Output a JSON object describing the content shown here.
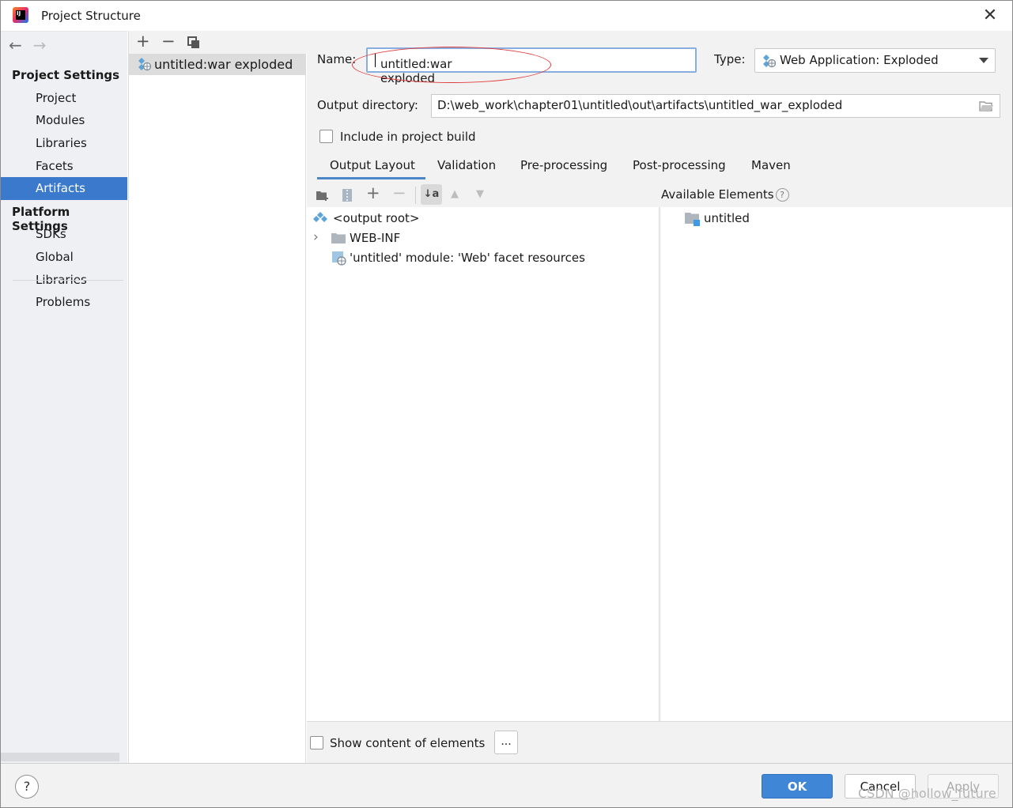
{
  "window": {
    "title": "Project Structure",
    "close_glyph": "✕",
    "app_icon_text": "IJ"
  },
  "nav": {
    "back_glyph": "←",
    "forward_glyph": "→",
    "project_settings_header": "Project Settings",
    "platform_settings_header": "Platform Settings",
    "items": [
      {
        "label": "Project"
      },
      {
        "label": "Modules"
      },
      {
        "label": "Libraries"
      },
      {
        "label": "Facets"
      },
      {
        "label": "Artifacts",
        "selected": true
      },
      {
        "label": "SDKs"
      },
      {
        "label": "Global Libraries"
      },
      {
        "label": "Problems"
      }
    ]
  },
  "artifacts_list": {
    "toolbar": {
      "add": "+",
      "remove": "−"
    },
    "items": [
      {
        "label": "untitled:war exploded",
        "selected": true
      }
    ]
  },
  "settings": {
    "name_label": "Name:",
    "name_value": "untitled:war exploded",
    "type_label": "Type:",
    "type_value": "Web Application: Exploded",
    "output_dir_label": "Output directory:",
    "output_dir_value": "D:\\web_work\\chapter01\\untitled\\out\\artifacts\\untitled_war_exploded",
    "include_in_build_label": "Include in project build",
    "include_in_build_checked": false
  },
  "tabs": [
    {
      "label": "Output Layout",
      "active": true
    },
    {
      "label": "Validation"
    },
    {
      "label": "Pre-processing"
    },
    {
      "label": "Post-processing"
    },
    {
      "label": "Maven"
    }
  ],
  "layout_toolbar": {
    "add": "+",
    "remove": "−",
    "sort_label": "↓a",
    "up": "▲",
    "down": "▼"
  },
  "output_tree": [
    {
      "label": "<output root>",
      "icon": "artifact-icon"
    },
    {
      "label": "WEB-INF",
      "icon": "folder-icon",
      "expander": "›"
    },
    {
      "label": "'untitled' module: 'Web' facet resources",
      "icon": "web-facet-icon"
    }
  ],
  "available": {
    "header": "Available Elements",
    "help": "?",
    "items": [
      {
        "label": "untitled",
        "icon": "module-folder-icon"
      }
    ]
  },
  "show_content_label": "Show content of elements",
  "show_content_checked": false,
  "dots_label": "...",
  "footer": {
    "help": "?",
    "ok": "OK",
    "cancel": "Cancel",
    "apply": "Apply"
  },
  "watermark": "CSDN @hollow_future",
  "colors": {
    "selection": "#3a79cc",
    "ok_button": "#3f86d6",
    "annotation_ellipse": "#e03c3c"
  }
}
